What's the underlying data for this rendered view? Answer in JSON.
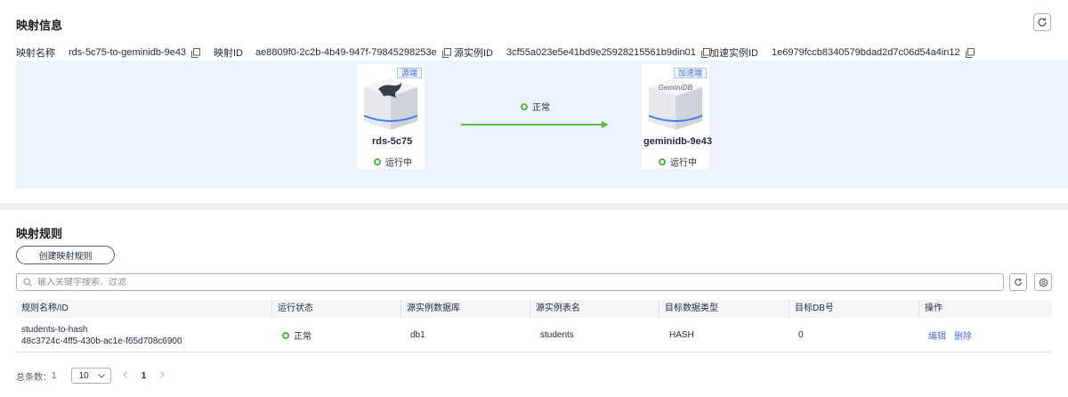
{
  "mapping_info": {
    "title": "映射信息",
    "items": [
      {
        "label": "映射名称",
        "value": "rds-5c75-to-geminidb-9e43"
      },
      {
        "label": "映射ID",
        "value": "ae8809f0-2c2b-4b49-947f-79845298253e"
      },
      {
        "label": "源实例ID",
        "value": "3cf55a023e5e41bd9e25928215561b9din01"
      },
      {
        "label": "加速实例ID",
        "value": "1e6979fccb8340579bdad2d7c06d54a4in12"
      }
    ],
    "source": {
      "tag": "源端",
      "name": "rds-5c75",
      "status": "运行中"
    },
    "target": {
      "tag": "加速端",
      "name": "geminidb-9e43",
      "status": "运行中",
      "logo_text": "GeminiDB"
    },
    "link_status": "正常",
    "colors": {
      "ok": "#50b347",
      "link": "#5fb544",
      "accent": "#526ecc",
      "topo_bg": "#ebf4fd"
    }
  },
  "mapping_rules": {
    "title": "映射规则",
    "create_label": "创建映射规则",
    "search_placeholder": "输入关键字搜索、过滤",
    "columns": [
      "规则名称/ID",
      "运行状态",
      "源实例数据库",
      "源实例表名",
      "目标数据类型",
      "目标DB号",
      "操作"
    ],
    "rows": [
      {
        "name": "students-to-hash",
        "id": "48c3724c-4ff5-430b-ac1e-f65d708c6900",
        "status": "正常",
        "database": "db1",
        "table": "students",
        "type": "HASH",
        "db_no": "0",
        "actions": [
          "编辑",
          "删除"
        ]
      }
    ],
    "pager": {
      "total_label": "总条数：",
      "total": "1",
      "page_size": "10",
      "current_page": "1"
    }
  }
}
